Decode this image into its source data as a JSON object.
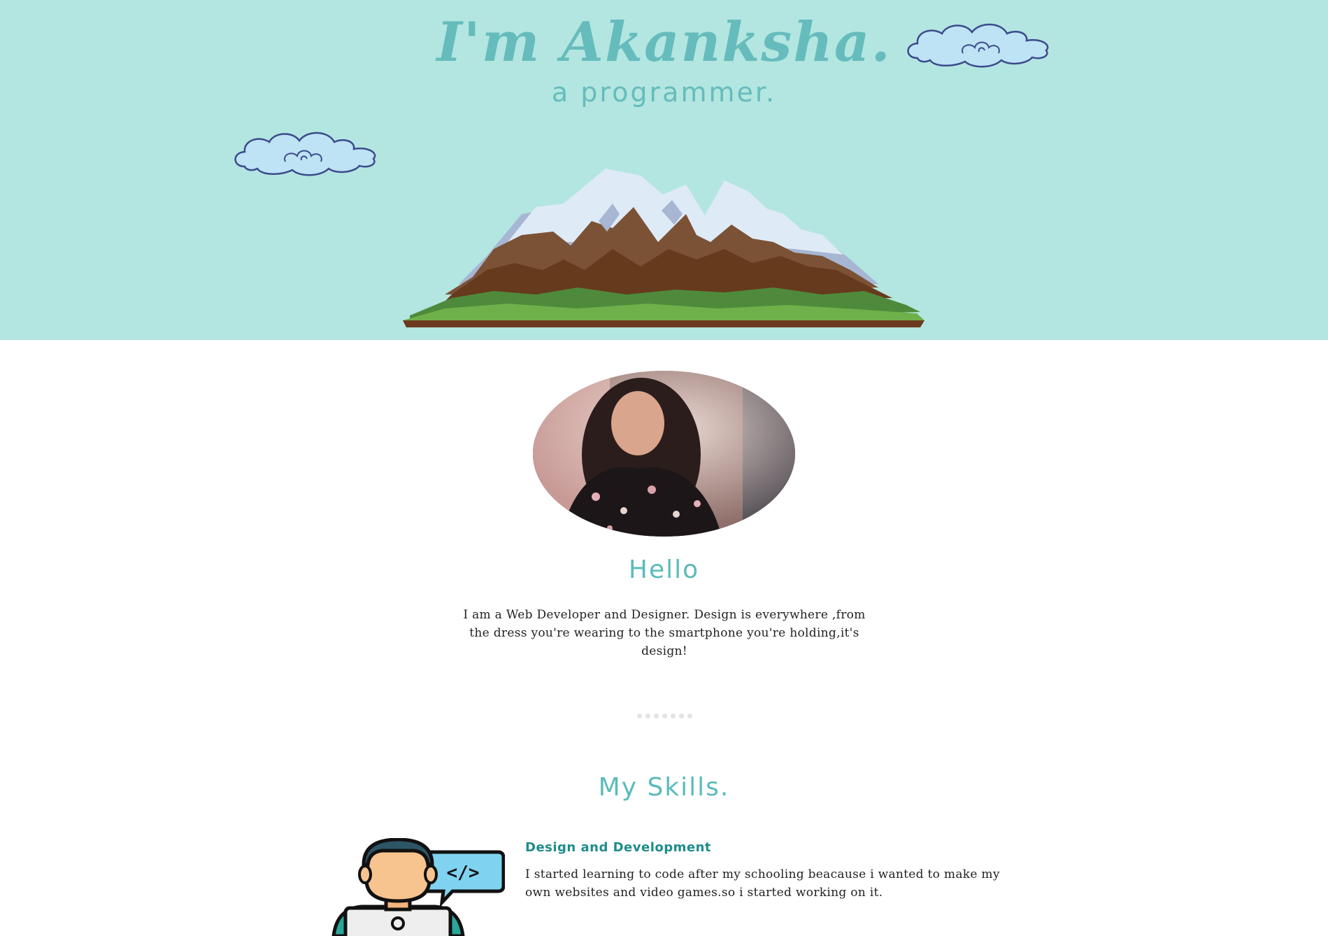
{
  "hero": {
    "title": "I'm Akanksha.",
    "subtitle": "a programmer.",
    "background_color": "#b3e6e1",
    "accent_color": "#66bcbc"
  },
  "about": {
    "heading": "Hello",
    "text": "I am a Web Developer and Designer. Design is everywhere ,from the dress you're wearing to the smartphone you're holding,it's design!"
  },
  "divider": {
    "dot_count": 7
  },
  "skills": {
    "heading": "My Skills.",
    "items": [
      {
        "title": "Design and Development",
        "text": "I started learning to code after my schooling beacause i wanted to make my own websites and video games.so i started working on it.",
        "icon": "developer-with-code-bubble-icon"
      }
    ]
  }
}
